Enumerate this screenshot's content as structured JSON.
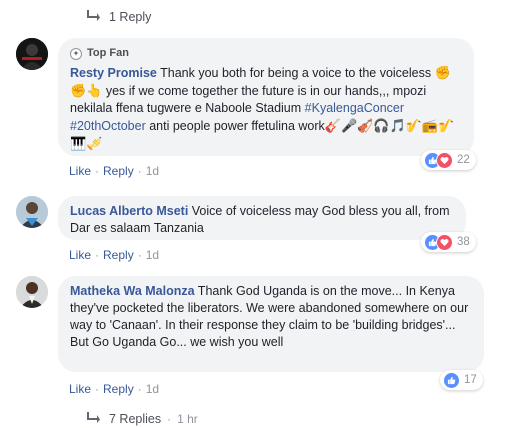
{
  "top_reply": {
    "label": "1 Reply"
  },
  "comments": [
    {
      "author": "Resty Promise",
      "badge": "Top Fan",
      "text_1": " Thank you both for being a voice to the voiceless ",
      "emoji_1": "✊✊👆",
      "text_2": " yes if we come together the future is in our hands,,, mpozi nekilala ffena tugwere e Naboole Stadium ",
      "hashtag_1": "#KyalengaConcer",
      "hashtag_2": "#20thOctober",
      "text_3": " anti people power ffetulina work",
      "emoji_2": "🎸🎤🎻🎧🎵🎷📻🎷🎹🎺",
      "like": "Like",
      "reply": "Reply",
      "time": "1d",
      "reaction_count": "22",
      "reactions": [
        "like",
        "love"
      ]
    },
    {
      "author": "Lucas Alberto Mseti",
      "text": " Voice of voiceless may God bless you all, from Dar es salaam Tanzania",
      "like": "Like",
      "reply": "Reply",
      "time": "1d",
      "reaction_count": "38",
      "reactions": [
        "like",
        "love"
      ]
    },
    {
      "author": "Matheka Wa Malonza",
      "text": " Thank God Uganda is on the move... In Kenya they've pocketed the liberators. We were abandoned somewhere on our way to 'Canaan'. In their response they claim to be 'building bridges'... But Go Uganda Go... we wish you well",
      "like": "Like",
      "reply": "Reply",
      "time": "1d",
      "reaction_count": "17",
      "reactions": [
        "like"
      ]
    }
  ],
  "bottom_reply": {
    "label": "7 Replies",
    "separator": "·",
    "time": "1 hr"
  },
  "colors": {
    "link": "#385898",
    "bubble": "#f2f3f5",
    "like": "#5890ff",
    "love": "#f25268"
  }
}
